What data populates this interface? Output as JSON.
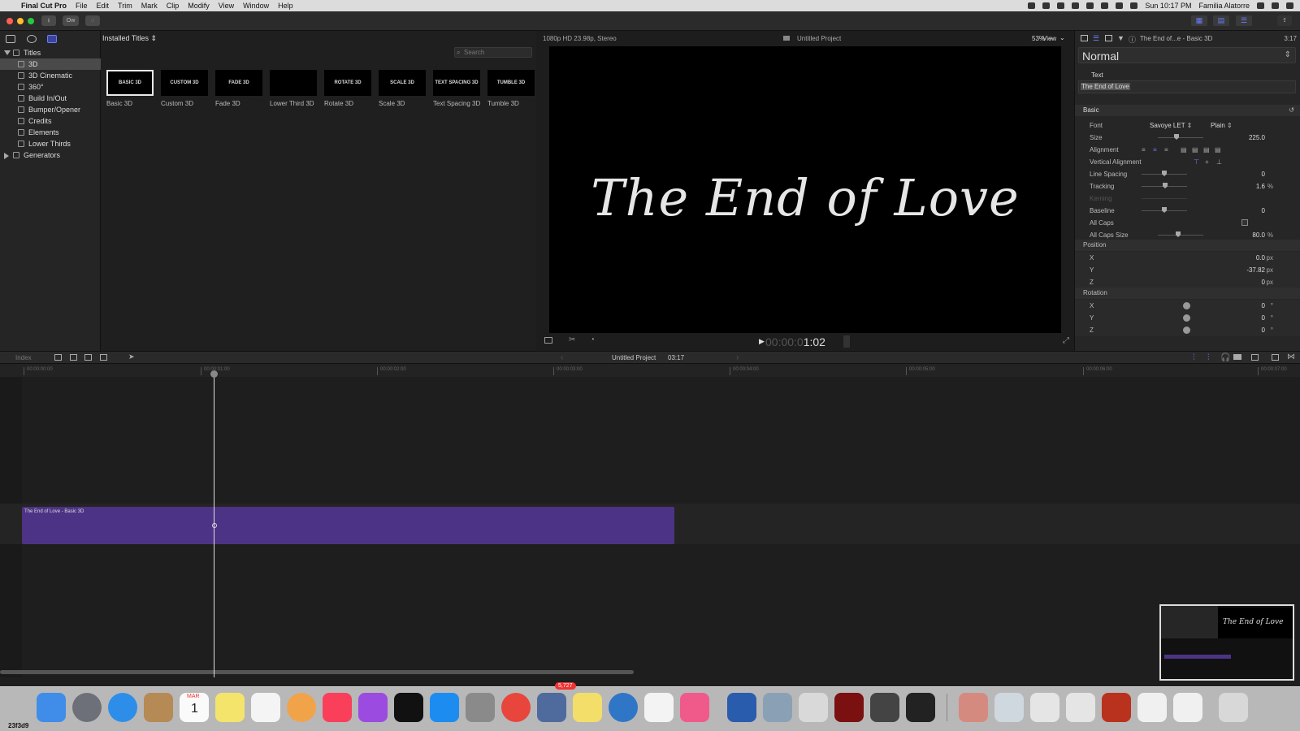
{
  "menubar": {
    "app": "Final Cut Pro",
    "menus": [
      "File",
      "Edit",
      "Trim",
      "Mark",
      "Clip",
      "Modify",
      "View",
      "Window",
      "Help"
    ],
    "datetime": "Sun 10:17 PM",
    "user": "Familia Alatorre"
  },
  "toolbar": {
    "ow_label": "Ow"
  },
  "sidebar": {
    "root": "Titles",
    "items": [
      "3D",
      "3D Cinematic",
      "360°",
      "Build In/Out",
      "Bumper/Opener",
      "Credits",
      "Elements",
      "Lower Thirds"
    ],
    "selected": "3D",
    "generators": "Generators"
  },
  "browser": {
    "header": "Installed Titles",
    "search_placeholder": "Search",
    "titles": [
      {
        "thumb": "BASIC 3D",
        "label": "Basic 3D"
      },
      {
        "thumb": "CUSTOM 3D",
        "label": "Custom 3D"
      },
      {
        "thumb": "FADE 3D",
        "label": "Fade 3D"
      },
      {
        "thumb": "",
        "label": "Lower Third 3D"
      },
      {
        "thumb": "ROTATE 3D",
        "label": "Rotate 3D"
      },
      {
        "thumb": "SCALE 3D",
        "label": "Scale 3D"
      },
      {
        "thumb": "TEXT SPACING 3D",
        "label": "Text Spacing 3D"
      },
      {
        "thumb": "TUMBLE 3D",
        "label": "Tumble 3D"
      }
    ]
  },
  "viewer": {
    "format": "1080p HD 23.98p, Stereo",
    "project": "Untitled Project",
    "zoom": "53%",
    "view_menu": "View",
    "title_text": "The End of Love",
    "timecode_dim": "00:00:0",
    "timecode_bright": "1:02"
  },
  "inspector": {
    "header_title": "The End of...e - Basic 3D",
    "duration": "3:17",
    "preset": "Normal",
    "text_label": "Text",
    "text_value": "The End of Love",
    "basic_label": "Basic",
    "font_label": "Font",
    "font_value": "Savoye LET",
    "font_style": "Plain",
    "rows": [
      {
        "k": "Size",
        "v": "225.0",
        "u": ""
      },
      {
        "k": "Alignment",
        "v": "",
        "u": ""
      },
      {
        "k": "Vertical Alignment",
        "v": "",
        "u": ""
      },
      {
        "k": "Line Spacing",
        "v": "0",
        "u": ""
      },
      {
        "k": "Tracking",
        "v": "1.6",
        "u": "%"
      },
      {
        "k": "Kerning",
        "v": "",
        "u": ""
      },
      {
        "k": "Baseline",
        "v": "0",
        "u": ""
      },
      {
        "k": "All Caps",
        "v": "",
        "u": ""
      },
      {
        "k": "All Caps Size",
        "v": "80.0",
        "u": "%"
      }
    ],
    "position_label": "Position",
    "position": [
      {
        "k": "X",
        "v": "0.0",
        "u": "px"
      },
      {
        "k": "Y",
        "v": "-37.82",
        "u": "px"
      },
      {
        "k": "Z",
        "v": "0",
        "u": "px"
      }
    ],
    "rotation_label": "Rotation",
    "rotation": [
      {
        "k": "X",
        "v": "0",
        "u": "°"
      },
      {
        "k": "Y",
        "v": "0",
        "u": "°"
      },
      {
        "k": "Z",
        "v": "0",
        "u": "°"
      }
    ]
  },
  "timeline": {
    "index_label": "Index",
    "project": "Untitled Project",
    "duration": "03:17",
    "ruler": [
      "00:00:00:00",
      "00:00:01:00",
      "00:00:02:00",
      "00:00:03:00",
      "00:00:04:00",
      "00:00:05:00",
      "00:00:06:00",
      "00:00:07:00"
    ],
    "clip_label": "The End of Love - Basic 3D"
  },
  "pip": {
    "title": "The End of Love"
  },
  "dock": {
    "badge": "5,727",
    "calendar_month": "MAR",
    "calendar_day": "1",
    "corner_text": "23f3d9"
  },
  "colors": {
    "accent": "#6b7cff",
    "clip": "#4d3385"
  }
}
